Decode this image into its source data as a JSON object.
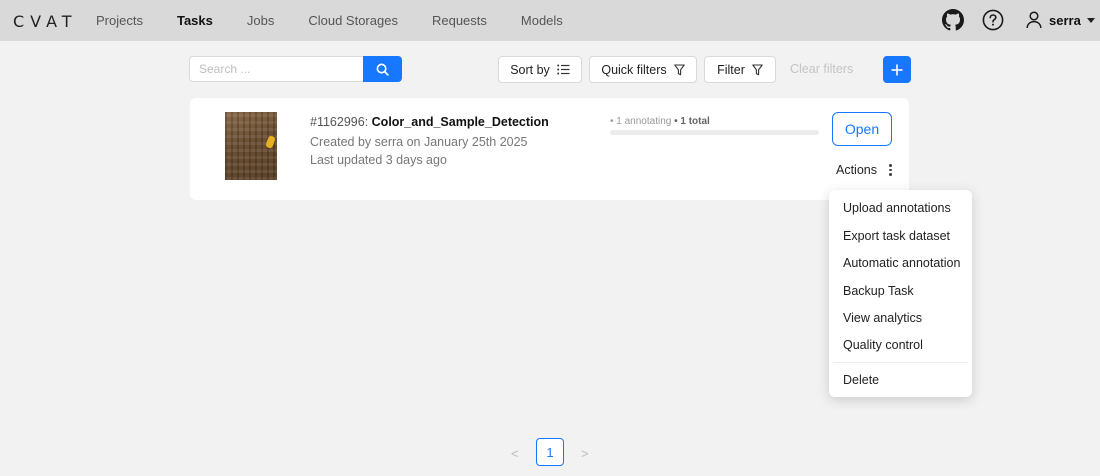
{
  "app": {
    "logo": "CVAT"
  },
  "nav": {
    "projects": "Projects",
    "tasks": "Tasks",
    "jobs": "Jobs",
    "cloud_storages": "Cloud Storages",
    "requests": "Requests",
    "models": "Models"
  },
  "header": {
    "github_icon": "github-icon",
    "help_icon": "question-circle-icon",
    "user_icon": "user-icon",
    "username": "serra"
  },
  "toolbar": {
    "search_placeholder": "Search ...",
    "sort_by": "Sort by",
    "quick_filters": "Quick filters",
    "filter": "Filter",
    "clear_filters": "Clear filters"
  },
  "task": {
    "id": "#1162996:",
    "name": "Color_and_Sample_Detection",
    "created": "Created by serra on January 25th 2025",
    "updated": "Last updated 3 days ago",
    "progress_annotating": "• 1 annotating",
    "progress_total": "• 1 total",
    "progress_fraction": 0,
    "open_label": "Open",
    "actions_label": "Actions"
  },
  "actions_menu": {
    "items": [
      "Upload annotations",
      "Export task dataset",
      "Automatic annotation",
      "Backup Task",
      "View analytics",
      "Quality control"
    ],
    "delete": "Delete"
  },
  "pagination": {
    "prev": "<",
    "current": "1",
    "next": ">"
  },
  "colors": {
    "primary": "#1677ff",
    "header_bg": "#d9d9d9",
    "page_bg": "#f2f2f2"
  }
}
